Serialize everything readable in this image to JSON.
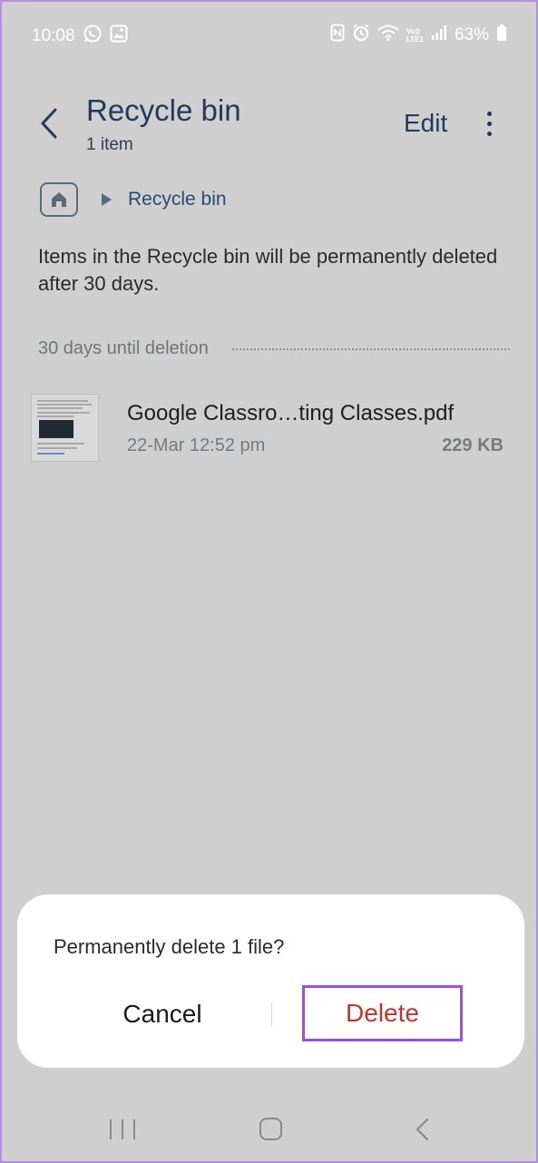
{
  "status_bar": {
    "time": "10:08",
    "battery": "63%",
    "left_icons": [
      "whatsapp-icon",
      "gallery-icon"
    ],
    "right_icons": [
      "nfc-icon",
      "alarm-icon",
      "wifi-icon",
      "volte-icon",
      "signal-icon",
      "battery-icon"
    ],
    "volte_top": "Vo))",
    "volte_bottom": "LTE1"
  },
  "header": {
    "title": "Recycle bin",
    "subtitle": "1 item",
    "edit_label": "Edit"
  },
  "breadcrumb": {
    "current": "Recycle bin"
  },
  "info_text": "Items in the Recycle bin will be permanently deleted after 30 days.",
  "section": {
    "label": "30 days until deletion"
  },
  "files": [
    {
      "name": "Google Classro…ting Classes.pdf",
      "date": "22-Mar 12:52 pm",
      "size": "229 KB"
    }
  ],
  "dialog": {
    "message": "Permanently delete 1 file?",
    "cancel_label": "Cancel",
    "delete_label": "Delete"
  },
  "colors": {
    "scrim": "#cfcfcf",
    "title": "#1f3a5c",
    "delete": "#c4342d",
    "highlight": "#a24ce6"
  }
}
